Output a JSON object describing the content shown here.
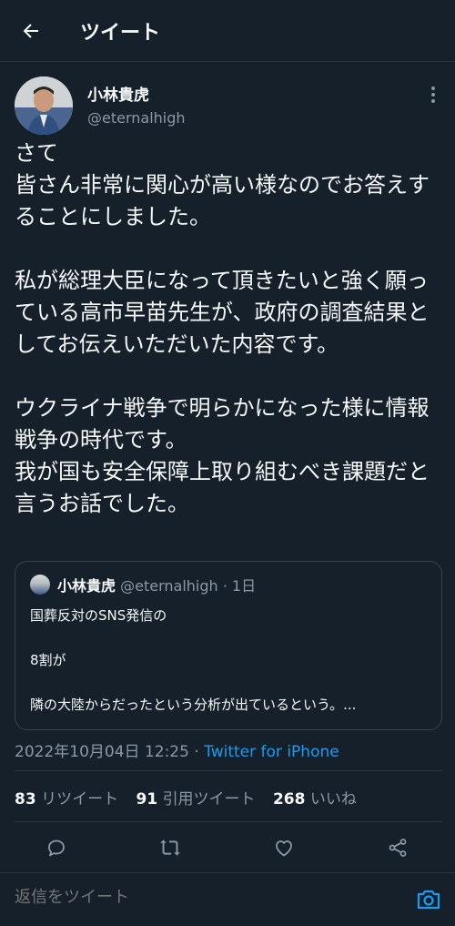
{
  "header": {
    "title": "ツイート",
    "back_icon": "arrow-left-icon"
  },
  "author": {
    "display_name": "小林貴虎",
    "handle": "@eternalhigh"
  },
  "tweet": {
    "text": "さて\n皆さん非常に関心が高い様なのでお答えすることにしました。\n\n私が総理大臣になって頂きたいと強く願っている高市早苗先生が、政府の調査結果としてお伝えいただいた内容です。\n\nウクライナ戦争で明らかになった様に情報戦争の時代です。\n我が国も安全保障上取り組むべき課題だと言うお話でした。"
  },
  "quote": {
    "display_name": "小林貴虎",
    "handle": "@eternalhigh",
    "separator": " · ",
    "time": "1日",
    "lines": [
      "国葬反対のSNS発信の",
      "8割が",
      "隣の大陸からだったという分析が出ているという。..."
    ]
  },
  "meta": {
    "timestamp": "2022年10月04日 12:25",
    "separator": " · ",
    "source": "Twitter for iPhone"
  },
  "stats": {
    "retweets_count": "83",
    "retweets_label": "リツイート",
    "quotes_count": "91",
    "quotes_label": "引用ツイート",
    "likes_count": "268",
    "likes_label": "いいね"
  },
  "actions": [
    "reply-icon",
    "retweet-icon",
    "like-icon",
    "share-icon"
  ],
  "reply_bar": {
    "placeholder": "返信をツイート",
    "camera_icon": "camera-icon"
  },
  "colors": {
    "background": "#15202b",
    "text": "#f7f9f9",
    "muted": "#8b98a5",
    "accent": "#1d9bf0",
    "border": "#38444d"
  }
}
